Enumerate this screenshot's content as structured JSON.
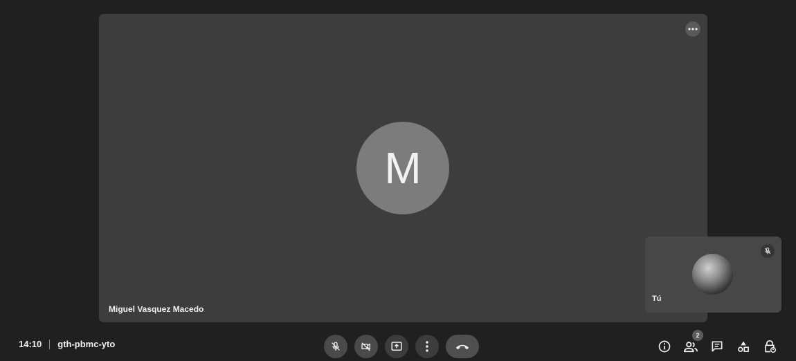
{
  "main_tile": {
    "avatar_initial": "M",
    "participant_name": "Miguel Vasquez Macedo"
  },
  "self_tile": {
    "label": "Tú"
  },
  "bottom_bar": {
    "time": "14:10",
    "meeting_code": "gth-pbmc-yto",
    "participants_count": "2"
  },
  "icons": {
    "tile_menu": "more-horizontal-icon",
    "self_mic": "mic-off-icon",
    "mic": "mic-off-icon",
    "camera": "videocam-off-icon",
    "present": "present-screen-icon",
    "more": "more-vertical-icon",
    "end_call": "call-end-icon",
    "info": "info-icon",
    "people": "people-icon",
    "chat": "chat-icon",
    "activities": "activities-icon",
    "host_controls": "lock-person-icon"
  },
  "colors": {
    "background": "#202020",
    "main_tile": "#3d3d3d",
    "avatar": "#7c7c7c"
  }
}
